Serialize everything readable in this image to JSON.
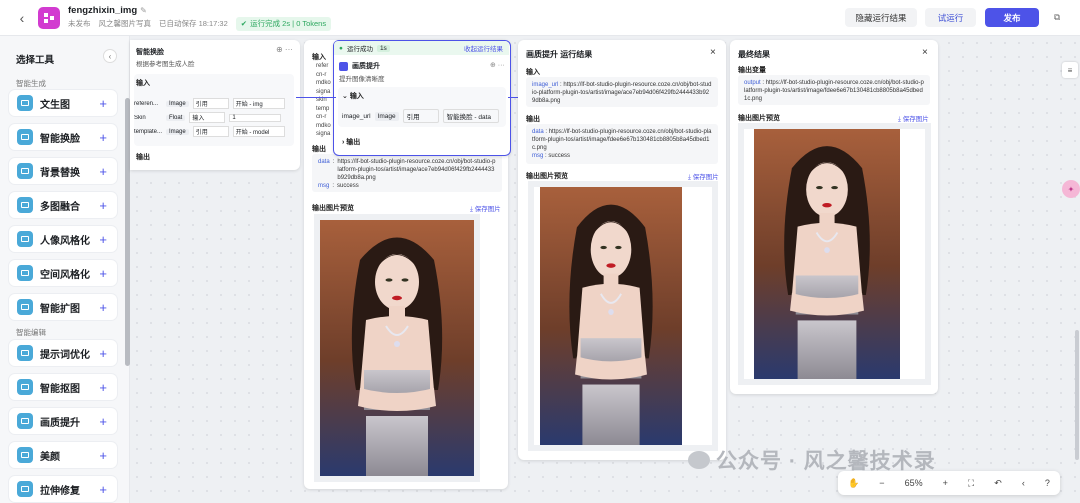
{
  "header": {
    "back_icon": "chevron-left-icon",
    "app_icon": "workflow-icon",
    "title": "fengzhixin_img",
    "unpublished": "未发布",
    "description": "风之馨图片写真",
    "autosave": "已自动保存 18:17:32",
    "run_status": "运行完成 2s | 0 Tokens",
    "hide_results": "隐藏运行结果",
    "try_run": "试运行",
    "publish": "发布"
  },
  "sidebar": {
    "heading": "选择工具",
    "section_gen": "智能生成",
    "section_edit": "智能编辑",
    "gen_items": [
      "文生图",
      "智能换脸",
      "背景替换",
      "多图融合",
      "人像风格化",
      "空间风格化",
      "智能扩图"
    ],
    "edit_items": [
      "提示词优化",
      "智能抠图",
      "画质提升",
      "美颜",
      "拉伸修复"
    ]
  },
  "node_left": {
    "title": "智能换脸",
    "subtitle": "根据参考图生成人脸",
    "input": "输入",
    "output": "输出",
    "params": [
      {
        "name": "referen...",
        "type": "Image",
        "mode": "引用",
        "value": "开始 - img"
      },
      {
        "name": "Skin",
        "type": "Float",
        "mode": "输入",
        "value": "1"
      },
      {
        "name": "template...",
        "type": "Image",
        "mode": "引用",
        "value": "开始 - model"
      }
    ]
  },
  "node_mid": {
    "run_ok": "运行成功",
    "time": "1s",
    "view_result": "收起运行结果",
    "title": "画质提升",
    "subtitle": "提升图像清晰度",
    "input": "输入",
    "param_name": "image_url",
    "param_type": "Image",
    "param_mode": "引用",
    "param_value": "智能换脸 - data",
    "output": "输出"
  },
  "result_face": {
    "input_lbl": "输入",
    "output_lbl": "输出",
    "partial": [
      "refer",
      "cn-r",
      "mdko",
      "signa",
      "skin",
      "temp",
      "cn-r",
      "mdko",
      "signa"
    ],
    "data_key": "data",
    "data_val": "https://lf-bot-studio-plugin-resource.coze.cn/obj/bot-studio-platform-plugin-tos/artist/image/ace7eb94d06f429fb2444433b929db8a.png",
    "msg_key": "msg",
    "msg_val": "success",
    "preview": "输出图片预览",
    "save": "保存图片"
  },
  "result_q": {
    "title": "画质提升 运行结果",
    "input_lbl": "输入",
    "output_lbl": "输出",
    "in_key": "image_url",
    "in_val": "https://lf-bot-studio-plugin-resource.coze.cn/obj/bot-studio-platform-plugin-tos/artist/image/ace7eb94d06f429fb2444433b929db8a.png",
    "data_key": "data",
    "data_val": "https://lf-bot-studio-plugin-resource.coze.cn/obj/bot-studio-platform-plugin-tos/artist/image/fdee6e67b130481cb8805b8a45dbed1c.png",
    "msg_key": "msg",
    "msg_val": "success",
    "preview": "输出图片预览",
    "save": "保存图片"
  },
  "result_end": {
    "title": "最终结果",
    "var_lbl": "输出变量",
    "out_key": "output",
    "out_val": "https://lf-bot-studio-plugin-resource.coze.cn/obj/bot-studio-platform-plugin-tos/artist/image/fdee6e67b130481cb8805b8a45dbed1c.png",
    "preview": "输出图片预览",
    "save": "保存图片"
  },
  "toolbar": {
    "zoom": "65%"
  },
  "watermark": "公众号 · 风之馨技术录"
}
